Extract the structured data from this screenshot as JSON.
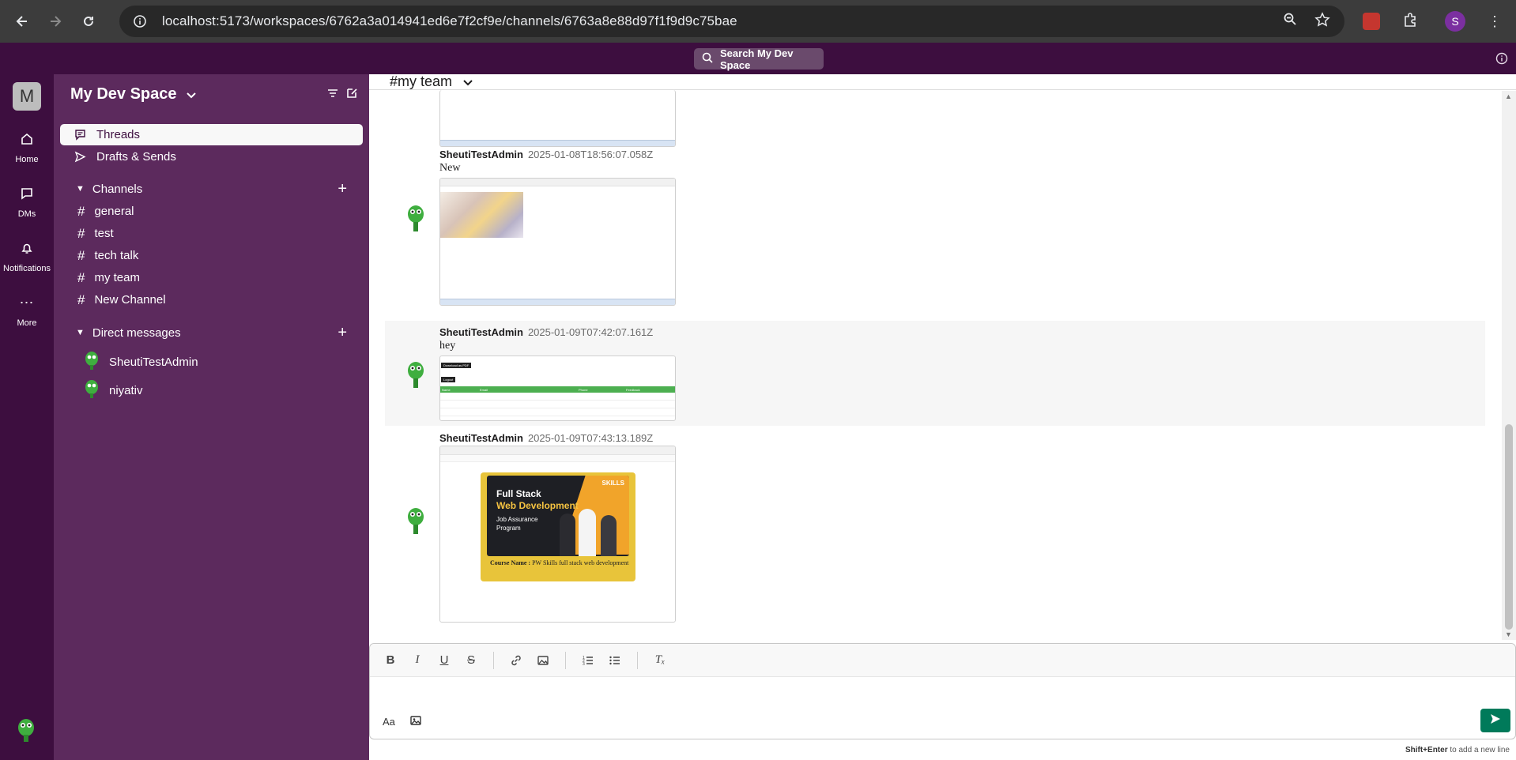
{
  "browser": {
    "url": "localhost:5173/workspaces/6762a3a014941ed6e7f2cf9e/channels/6763a8e88d97f1f9d9c75bae",
    "profile_initial": "S"
  },
  "topbar": {
    "search_label": "Search My Dev Space"
  },
  "rail": {
    "workspace_initial": "M",
    "items": [
      {
        "label": "Home",
        "icon": "home-icon"
      },
      {
        "label": "DMs",
        "icon": "chat-icon"
      },
      {
        "label": "Notifications",
        "icon": "bell-icon"
      },
      {
        "label": "More",
        "icon": "more-icon"
      }
    ]
  },
  "sidebar": {
    "workspace_name": "My Dev Space",
    "quick_items": [
      {
        "label": "Threads",
        "icon": "threads-icon",
        "active": true
      },
      {
        "label": "Drafts & Sends",
        "icon": "send-icon",
        "active": false
      }
    ],
    "channels_heading": "Channels",
    "channels": [
      {
        "name": "general"
      },
      {
        "name": "test"
      },
      {
        "name": "tech talk"
      },
      {
        "name": "my team"
      },
      {
        "name": "New Channel"
      }
    ],
    "dms_heading": "Direct messages",
    "dms": [
      {
        "name": "SheutiTestAdmin"
      },
      {
        "name": "niyativ"
      }
    ]
  },
  "channel": {
    "title": "#my team"
  },
  "messages": [
    {
      "author": "SheutiTestAdmin",
      "timestamp": "2025-01-08T18:56:07.058Z",
      "text": "New"
    },
    {
      "author": "SheutiTestAdmin",
      "timestamp": "2025-01-09T07:42:07.161Z",
      "text": "hey"
    },
    {
      "author": "SheutiTestAdmin",
      "timestamp": "2025-01-09T07:43:13.189Z",
      "text": ""
    }
  ],
  "attachment_table": {
    "button_pdf": "Download as PDF",
    "button_logout": "Logout",
    "headers": [
      "Name",
      "Email",
      "Phone",
      "Feedback"
    ]
  },
  "course_card": {
    "brand": "SKILLS",
    "line1": "Full Stack",
    "line2": "Web Development",
    "line3": "Job Assurance",
    "line4": "Program",
    "caption_label": "Course Name :",
    "caption_value": "PW Skills full stack web development"
  },
  "composer": {
    "hint_keys": "Shift+Enter",
    "hint_text": "to add a new line"
  },
  "colors": {
    "rail": "#3d0e3f",
    "sidebar": "#5c2a5d",
    "send_button": "#007a5a",
    "table_header": "#4caf50"
  }
}
